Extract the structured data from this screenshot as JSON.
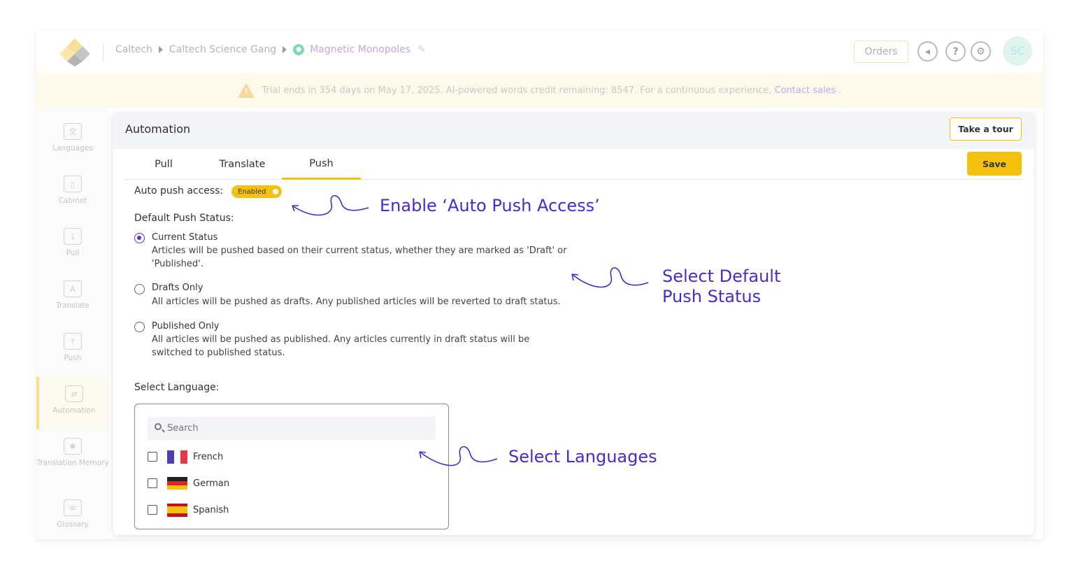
{
  "breadcrumb": {
    "org": "Caltech",
    "workspace": "Caltech Science Gang",
    "project": "Magnetic Monopoles"
  },
  "header": {
    "orders_label": "Orders",
    "avatar_initials": "SC"
  },
  "trial_banner": {
    "message": "Trial ends in 354 days on May 17, 2025. AI-powered words credit remaining: 8547. For a continuous experience,",
    "link": "Contact sales",
    "suffix": "."
  },
  "sidebar": {
    "items": [
      {
        "label": "Languages",
        "icon": "languages-icon"
      },
      {
        "label": "Cabinet",
        "icon": "cabinet-icon"
      },
      {
        "label": "Pull",
        "icon": "pull-icon"
      },
      {
        "label": "Translate",
        "icon": "translate-icon"
      },
      {
        "label": "Push",
        "icon": "push-icon"
      },
      {
        "label": "Automation",
        "icon": "automation-icon",
        "active": true
      },
      {
        "label": "Translation Memory",
        "icon": "translation-memory-icon"
      },
      {
        "label": "Glossary",
        "icon": "glossary-icon"
      }
    ]
  },
  "automation": {
    "title": "Automation",
    "tour_label": "Take a tour",
    "save_label": "Save",
    "tabs": [
      "Pull",
      "Translate",
      "Push"
    ],
    "active_tab": "Push",
    "auto_push_label": "Auto push access:",
    "auto_push_state": "Enabled",
    "default_status_label": "Default Push Status:",
    "options": [
      {
        "title": "Current Status",
        "desc": "Articles will be pushed based on their current status, whether they are marked as 'Draft' or 'Published'.",
        "checked": true
      },
      {
        "title": "Drafts Only",
        "desc": "All articles will be pushed as drafts. Any published articles will be reverted to draft status.",
        "checked": false
      },
      {
        "title": "Published Only",
        "desc": "All articles will be pushed as published. Any articles currently in draft status will be switched to published status.",
        "checked": false
      }
    ],
    "select_language_label": "Select Language:",
    "search_placeholder": "Search",
    "languages": [
      {
        "name": "French",
        "checked": false
      },
      {
        "name": "German",
        "checked": false
      },
      {
        "name": "Spanish",
        "checked": false
      }
    ]
  },
  "annotations": {
    "enable_push": "Enable ‘Auto Push Access’",
    "select_status_line1": "Select Default",
    "select_status_line2": "Push Status",
    "select_languages": "Select Languages"
  },
  "colors": {
    "accent_yellow": "#f4c20d",
    "annotation_purple": "#4a2ad0",
    "radio_purple": "#5b2fc8"
  }
}
